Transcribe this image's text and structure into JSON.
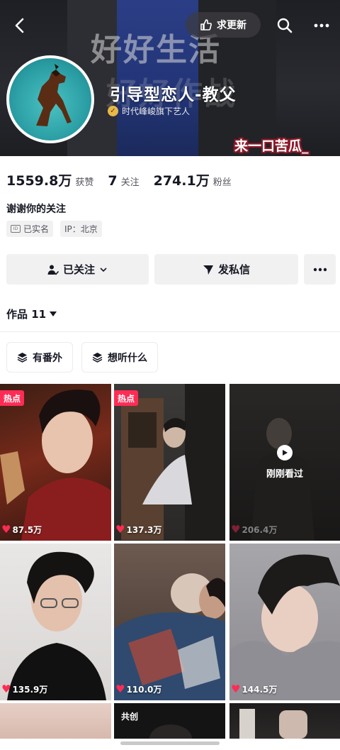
{
  "header": {
    "update_label": "求更新",
    "banner_text_line1": "好好生活",
    "banner_text_line2": "好好作战",
    "nickname": "引导型恋人-教父",
    "verified_text": "时代峰峻旗下艺人",
    "watermark": "来一口苦瓜_"
  },
  "stats": [
    {
      "value": "1559.8万",
      "label": "获赞"
    },
    {
      "value": "7",
      "label": "关注"
    },
    {
      "value": "274.1万",
      "label": "粉丝"
    }
  ],
  "profile": {
    "bio": "谢谢你的关注",
    "tags": [
      "已实名",
      "IP：北京"
    ]
  },
  "actions": {
    "follow_label": "已关注",
    "message_label": "发私信"
  },
  "works": {
    "tab_label": "作品 11",
    "chips": [
      "有番外",
      "想听什么"
    ]
  },
  "videos": [
    {
      "likes": "87.5万",
      "badge": "热点"
    },
    {
      "likes": "137.3万",
      "badge": "热点"
    },
    {
      "likes": "206.4万",
      "overlay": "刚刚看过"
    },
    {
      "likes": "135.9万"
    },
    {
      "likes": "110.0万"
    },
    {
      "likes": "144.5万"
    }
  ],
  "partial_row": {
    "middle_caption": "共创"
  },
  "colors": {
    "accent_red": "#fe2c55",
    "button_bg": "#f1f1f2",
    "banner_blue": "#2c3f8a"
  },
  "icons": [
    "back-icon",
    "thumb-icon",
    "search-icon",
    "more-icon",
    "user-check-icon",
    "chevron-down-icon",
    "send-icon",
    "layers-icon",
    "play-icon",
    "heart-icon",
    "triangle-down-icon"
  ]
}
